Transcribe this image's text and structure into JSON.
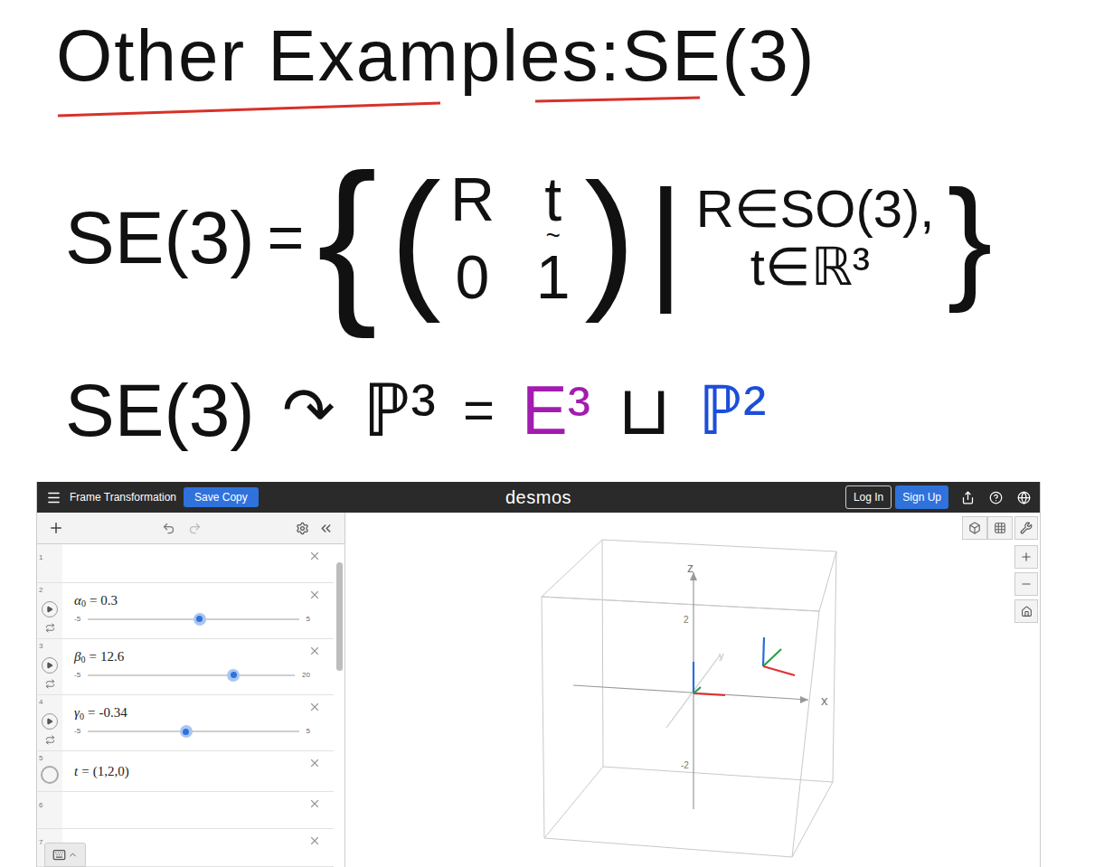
{
  "notes": {
    "title": "Other Examples:SE(3)",
    "definition": {
      "lhs": "SE(3)",
      "eq": "=",
      "open": "{",
      "matrix": [
        [
          {
            "text": "R",
            "under": ""
          },
          {
            "text": "t",
            "under": "~"
          }
        ],
        [
          {
            "text": "0",
            "under": ""
          },
          {
            "text": "1",
            "under": ""
          }
        ]
      ],
      "bar": "|",
      "conditions": [
        "R∈SO(3),",
        "t∈ℝ³"
      ],
      "close": "}"
    },
    "action": {
      "lhs": "SE(3)",
      "acts": "↷",
      "space": "ℙ³",
      "eq": "=",
      "parts": [
        {
          "text": "E³",
          "color": "#a21caf"
        },
        {
          "text": "⊔",
          "color": "#111111"
        },
        {
          "text": "ℙ²",
          "color": "#1d4ed8"
        }
      ]
    }
  },
  "desmos": {
    "title": "Frame Transformation",
    "save_button": "Save Copy",
    "logo": "desmos",
    "login_button": "Log In",
    "signup_button": "Sign Up",
    "expressions": [
      {
        "num": "1",
        "kind": "empty"
      },
      {
        "num": "2",
        "kind": "slider",
        "name": "α",
        "sub": "0",
        "eq": "=",
        "value": "0.3",
        "min": "-5",
        "max": "5",
        "level": 0.53
      },
      {
        "num": "3",
        "kind": "slider",
        "name": "β",
        "sub": "0",
        "eq": "=",
        "value": "12.6",
        "min": "-5",
        "max": "20",
        "level": 0.704
      },
      {
        "num": "4",
        "kind": "slider",
        "name": "γ",
        "sub": "0",
        "eq": "=",
        "value": "-0.34",
        "min": "-5",
        "max": "5",
        "level": 0.466
      },
      {
        "num": "5",
        "kind": "point",
        "name": "t",
        "sub": "",
        "eq": "=",
        "value": "(1,2,0)"
      },
      {
        "num": "6",
        "kind": "empty"
      },
      {
        "num": "7",
        "kind": "empty"
      }
    ],
    "graph": {
      "axis_labels": {
        "x": "x",
        "y": "y",
        "z": "z"
      },
      "ticks": [
        {
          "text": "2",
          "axis": "z"
        },
        {
          "text": "-2",
          "axis": "z"
        }
      ]
    }
  }
}
